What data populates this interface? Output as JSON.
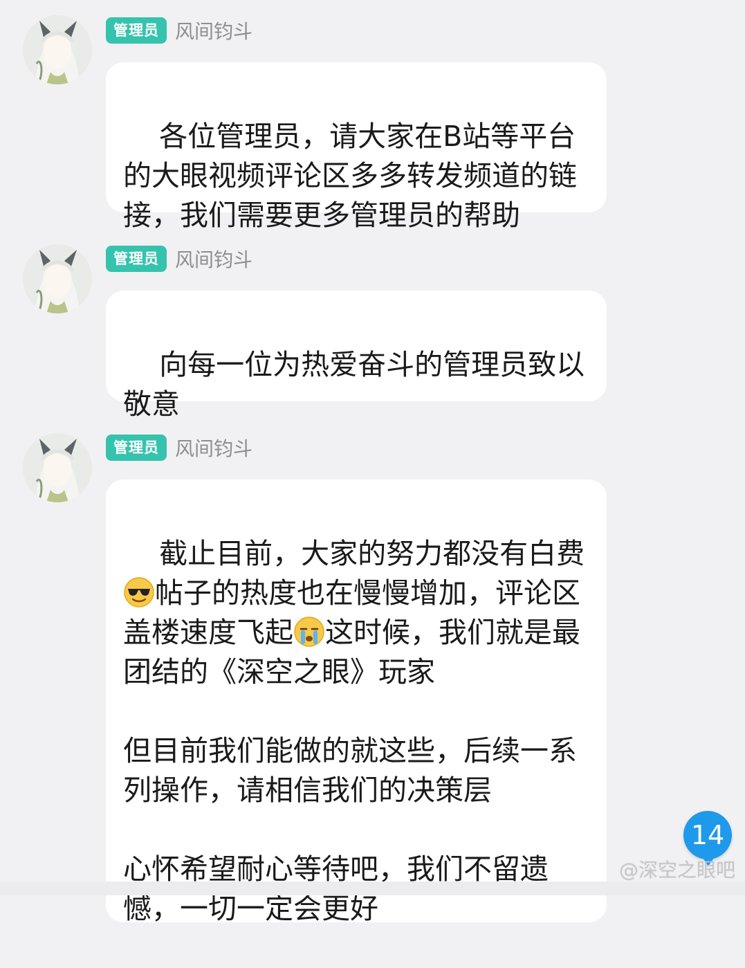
{
  "messages": [
    {
      "role_badge": "管理员",
      "sender": "风间钧斗",
      "text": "各位管理员，请大家在B站等平台的大眼视频评论区多多转发频道的链接，我们需要更多管理员的帮助"
    },
    {
      "role_badge": "管理员",
      "sender": "风间钧斗",
      "text": "向每一位为热爱奋斗的管理员致以敬意"
    },
    {
      "role_badge": "管理员",
      "sender": "风间钧斗",
      "text_part1": "截止目前，大家的努力都没有白费",
      "emoji1": "sunglasses-emoji",
      "text_part2": "帖子的热度也在慢慢增加，评论区盖楼速度飞起",
      "emoji2": "crying-emoji",
      "text_part3": "这时候，我们就是最团结的《深空之眼》玩家\n\n但目前我们能做的就这些，后续一系列操作，请相信我们的决策层\n\n心怀希望耐心等待吧，我们不留遗憾，一切一定会更好"
    }
  ],
  "unread_counter": "14",
  "watermark": "@深空之眼吧",
  "colors": {
    "badge": "#35c3ad",
    "background": "#f1f1f3",
    "counter": "#1f9aea"
  }
}
